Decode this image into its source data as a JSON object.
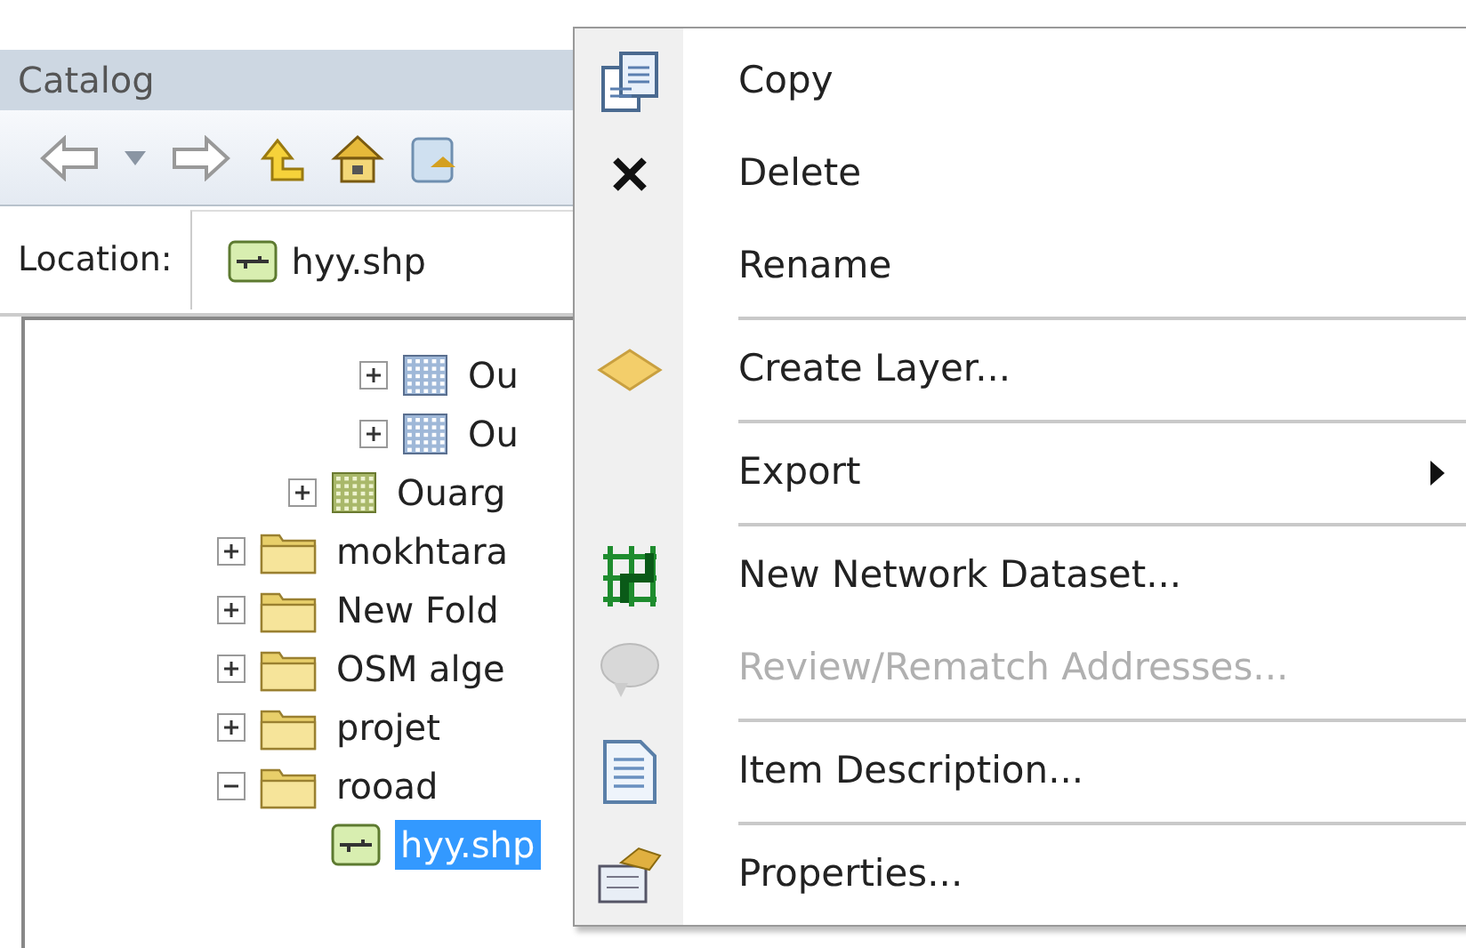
{
  "panel": {
    "title": "Catalog"
  },
  "toolbar": [
    {
      "kind": "back"
    },
    {
      "kind": "caret"
    },
    {
      "kind": "forward"
    },
    {
      "kind": "up"
    },
    {
      "kind": "home"
    },
    {
      "kind": "connect"
    }
  ],
  "location": {
    "label": "Location:",
    "value": "hyy.shp"
  },
  "tree": [
    {
      "children": [
        {
          "children": [
            {
              "label": "Ou",
              "kind": "raster",
              "expanded": false,
              "selected": false
            },
            {
              "label": "Ou",
              "kind": "raster",
              "expanded": false,
              "selected": false
            }
          ]
        },
        {
          "label": "Ouarg",
          "kind": "raster-group",
          "expanded": false,
          "selected": false
        }
      ]
    },
    {
      "label": "mokhtara",
      "kind": "folder",
      "expanded": false,
      "selected": false
    },
    {
      "label": "New Fold",
      "kind": "folder",
      "expanded": false,
      "selected": false
    },
    {
      "label": "OSM alge",
      "kind": "folder",
      "expanded": false,
      "selected": false
    },
    {
      "label": "projet",
      "kind": "folder",
      "expanded": false,
      "selected": false
    },
    {
      "label": "rooad",
      "kind": "folder",
      "expanded": true,
      "selected": false,
      "children": [
        {
          "label": "hyy.shp",
          "kind": "shapefile",
          "selected": true
        }
      ]
    }
  ],
  "context_menu": [
    {
      "label": "Copy",
      "kind": "copy",
      "disabled": false
    },
    {
      "label": "Delete",
      "kind": "delete",
      "disabled": false
    },
    {
      "label": "Rename",
      "kind": "plain",
      "disabled": false
    },
    {
      "label": "Create Layer...",
      "kind": "layer",
      "disabled": false,
      "separator_before": true
    },
    {
      "label": "Export",
      "kind": "plain",
      "disabled": false,
      "separator_before": true,
      "submenu": true
    },
    {
      "label": "New Network Dataset...",
      "kind": "network",
      "disabled": false,
      "separator_before": true
    },
    {
      "label": "Review/Rematch Addresses...",
      "kind": "review",
      "disabled": true
    },
    {
      "label": "Item Description...",
      "kind": "description",
      "disabled": false,
      "separator_before": true
    },
    {
      "label": "Properties...",
      "kind": "properties",
      "disabled": false,
      "separator_before": true
    }
  ]
}
